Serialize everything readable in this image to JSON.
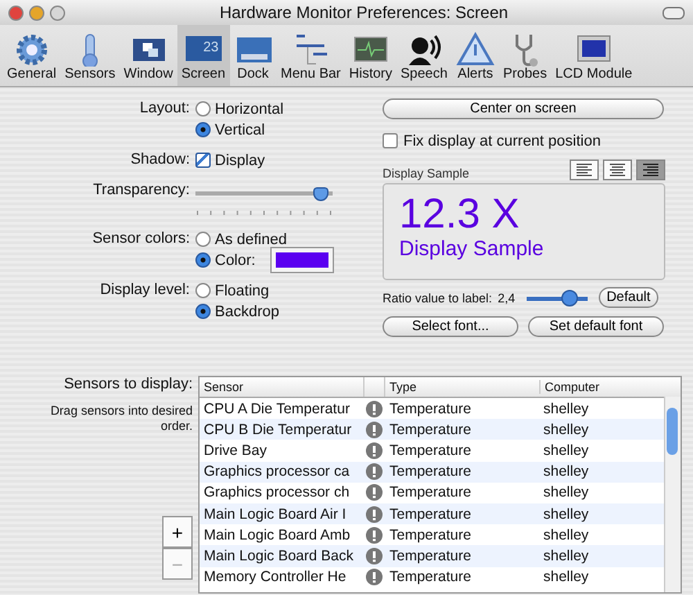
{
  "window": {
    "title": "Hardware Monitor Preferences: Screen"
  },
  "toolbar": {
    "items": [
      {
        "label": "General",
        "selected": false
      },
      {
        "label": "Sensors",
        "selected": false
      },
      {
        "label": "Window",
        "selected": false
      },
      {
        "label": "Screen",
        "selected": true
      },
      {
        "label": "Dock",
        "selected": false
      },
      {
        "label": "Menu Bar",
        "selected": false
      },
      {
        "label": "History",
        "selected": false
      },
      {
        "label": "Speech",
        "selected": false
      },
      {
        "label": "Alerts",
        "selected": false
      },
      {
        "label": "Probes",
        "selected": false
      },
      {
        "label": "LCD Module",
        "selected": false
      }
    ],
    "calendar_digits": "23"
  },
  "form": [
    {
      "kind": "radio",
      "label": "Layout:",
      "options": [
        {
          "label": "Horizontal",
          "selected": false
        },
        {
          "label": "Vertical",
          "selected": true
        }
      ]
    },
    {
      "kind": "checkbox",
      "label": "Shadow:",
      "option": "Display",
      "checked": true
    },
    {
      "kind": "slider",
      "label": "Transparency:",
      "level": 0.97
    },
    {
      "kind": "radio",
      "label": "Sensor colors:",
      "options": [
        {
          "label": "As defined",
          "selected": false
        },
        {
          "label": "Color:",
          "selected": true,
          "color": "#5a00f0"
        }
      ]
    },
    {
      "kind": "radio",
      "label": "Display level:",
      "options": [
        {
          "label": "Floating",
          "selected": false
        },
        {
          "label": "Backdrop",
          "selected": true
        }
      ]
    }
  ],
  "right": {
    "center_button": "Center on screen",
    "fix_checkbox": {
      "label": "Fix display at current position",
      "checked": false
    },
    "sample": {
      "title": "Display Sample",
      "align_buttons": [
        {
          "selected": false
        },
        {
          "selected": false
        },
        {
          "selected": true
        }
      ],
      "value": "12.3 X",
      "label": "Display Sample"
    },
    "ratio": {
      "label": "Ratio value to label:",
      "reading": "2,4",
      "level": 0.8
    },
    "default_button": "Default",
    "select_font_button": "Select font...",
    "default_font_button": "Set default font"
  },
  "sensors": {
    "label": "Sensors to display:",
    "hint": "Drag sensors into desired order.",
    "columns": [
      "Sensor",
      "Type",
      "Computer"
    ],
    "rows": [
      {
        "sensor": "CPU A Die Temperatur",
        "type": "Temperature",
        "computer": "shelley"
      },
      {
        "sensor": "CPU B Die Temperatur",
        "type": "Temperature",
        "computer": "shelley"
      },
      {
        "sensor": "Drive Bay",
        "type": "Temperature",
        "computer": "shelley"
      },
      {
        "sensor": "Graphics processor ca",
        "type": "Temperature",
        "computer": "shelley"
      },
      {
        "sensor": "Graphics processor ch",
        "type": "Temperature",
        "computer": "shelley"
      },
      {
        "sensor": "Main Logic Board Air I",
        "type": "Temperature",
        "computer": "shelley"
      },
      {
        "sensor": "Main Logic Board Amb",
        "type": "Temperature",
        "computer": "shelley"
      },
      {
        "sensor": "Main Logic Board Back",
        "type": "Temperature",
        "computer": "shelley"
      },
      {
        "sensor": "Memory Controller He",
        "type": "Temperature",
        "computer": "shelley"
      }
    ],
    "add_button": {
      "label": "+",
      "disabled": false
    },
    "remove_button": {
      "label": "−",
      "disabled": true
    }
  }
}
